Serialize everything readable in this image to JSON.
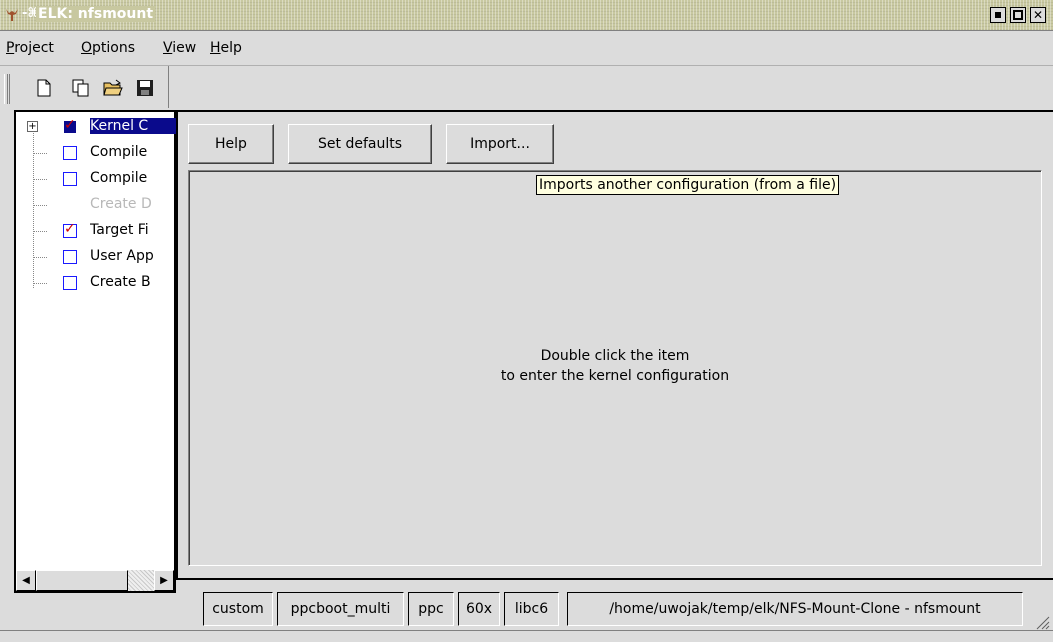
{
  "window": {
    "title": "ELK: nfsmount"
  },
  "menu": [
    {
      "label": "Project",
      "mnemonic": "P",
      "rest": "roject"
    },
    {
      "label": "Options",
      "mnemonic": "O",
      "rest": "ptions"
    },
    {
      "label": "View",
      "mnemonic": "V",
      "rest": "iew"
    },
    {
      "label": "Help",
      "mnemonic": "H",
      "rest": "elp"
    }
  ],
  "toolbar": {
    "icons": [
      "new-document-icon",
      "copy-document-icon",
      "open-folder-icon",
      "save-icon"
    ]
  },
  "tree": {
    "items": [
      {
        "label": "Kernel C",
        "state": "checked",
        "selected": true
      },
      {
        "label": "Compile",
        "state": "unchecked"
      },
      {
        "label": "Compile",
        "state": "unchecked"
      },
      {
        "label": "Create D",
        "state": "disabled"
      },
      {
        "label": "Target Fi",
        "state": "checked"
      },
      {
        "label": "User App",
        "state": "unchecked"
      },
      {
        "label": "Create B",
        "state": "unchecked"
      }
    ]
  },
  "buttons": {
    "help": "Help",
    "set_defaults": "Set defaults",
    "import": "Import..."
  },
  "tooltip": "Imports another configuration (from a file)",
  "content": {
    "line1": "Double click the item",
    "line2": "to enter the kernel configuration"
  },
  "status": {
    "cells": [
      "custom",
      "ppcboot_multi",
      "ppc",
      "60x",
      "libc6",
      "/home/uwojak/temp/elk/NFS-Mount-Clone - nfsmount"
    ]
  },
  "colors": {
    "selection": "#0a0a8c",
    "tooltip_bg": "#ffffe0",
    "checkbox_border": "#1a1aff",
    "checkmark": "#d00000"
  }
}
